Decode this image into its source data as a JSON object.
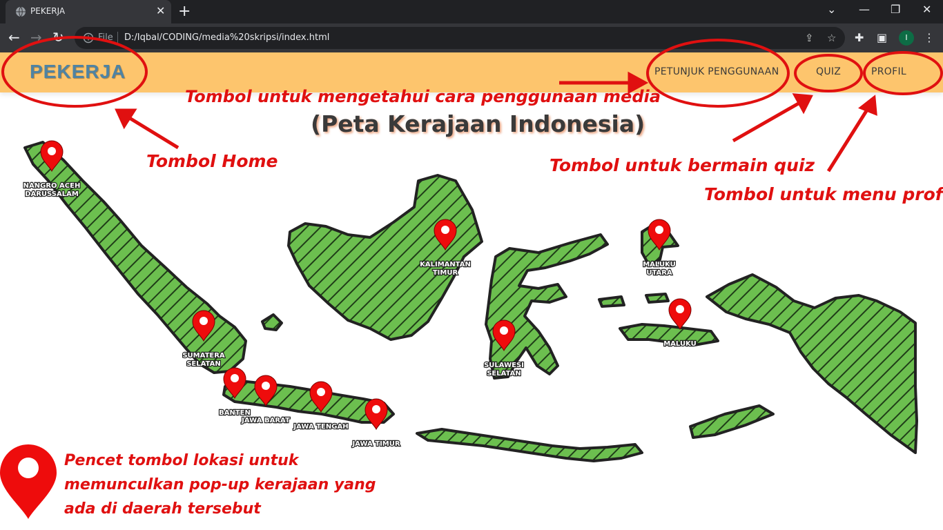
{
  "browser": {
    "tab_title": "PEKERJA",
    "address_prefix": "File",
    "url": "D:/Iqbal/CODING/media%20skripsi/index.html",
    "profile_initial": "I"
  },
  "navbar": {
    "brand": "PEKERJA",
    "items": [
      {
        "label": "PETUNJUK PENGGUNAAN"
      },
      {
        "label": "QUIZ"
      },
      {
        "label": "PROFIL"
      }
    ]
  },
  "page": {
    "title": "(Peta Kerajaan Indonesia)"
  },
  "annotations": {
    "home": "Tombol Home",
    "guide": "Tombol untuk mengetahui cara penggunaan media",
    "quiz": "Tombol untuk bermain quiz",
    "profile": "Tombol untuk menu profil",
    "pin_hint": [
      "Pencet tombol lokasi untuk",
      "memunculkan pop-up kerajaan yang",
      "ada di daerah tersebut"
    ]
  },
  "locations": [
    {
      "label": [
        "NANGRO ACEH",
        "DARUSSALAM"
      ]
    },
    {
      "label": [
        "SUMATERA",
        "SELATAN"
      ]
    },
    {
      "label": [
        "BANTEN"
      ]
    },
    {
      "label": [
        "JAWA BARAT"
      ]
    },
    {
      "label": [
        "JAWA TENGAH"
      ]
    },
    {
      "label": [
        "JAWA TIMUR"
      ]
    },
    {
      "label": [
        "KALIMANTAN",
        "TIMUR"
      ]
    },
    {
      "label": [
        "SULAWESI",
        "SELATAN"
      ]
    },
    {
      "label": [
        "MALUKU",
        "UTARA"
      ]
    },
    {
      "label": [
        "MALUKU"
      ]
    }
  ],
  "colors": {
    "accent_red": "#e01010",
    "map_green": "#6cbf4f",
    "navbar_bg": "#fdc56d",
    "brand_blue": "#4f83a3"
  }
}
